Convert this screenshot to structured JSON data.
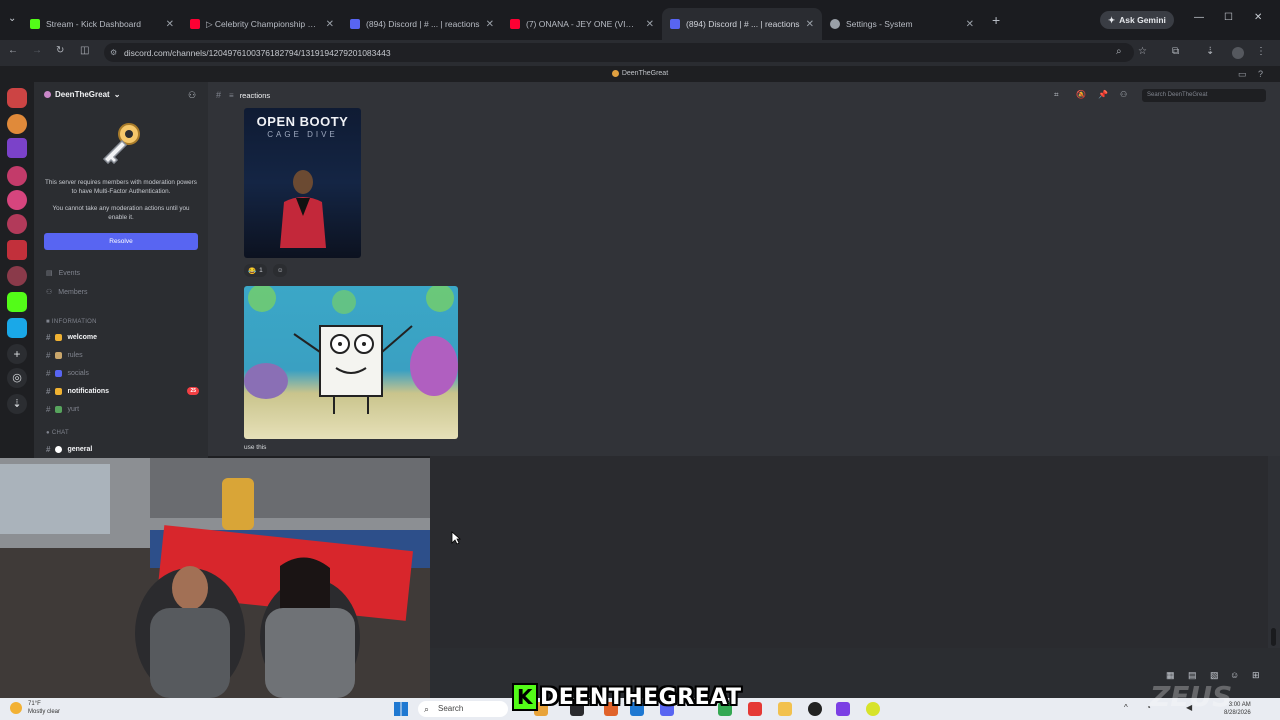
{
  "browser": {
    "tabs": [
      {
        "title": "Stream - Kick Dashboard",
        "color": "#53fc18"
      },
      {
        "title": "▷ Celebrity Championship Box",
        "color": "#ff0033"
      },
      {
        "title": "(894) Discord | # ... | reactions",
        "color": "#5865f2"
      },
      {
        "title": "(7) ONANA - JEY ONE (VIDEO O",
        "color": "#ff0033"
      },
      {
        "title": "(894) Discord | # ... | reactions",
        "color": "#5865f2"
      },
      {
        "title": "Settings - System",
        "color": "#9aa0a8"
      }
    ],
    "new_tab": "+",
    "ask_gemini": "Ask Gemini",
    "url": "discord.com/channels/1204976100376182794/1319194279201083443"
  },
  "discord": {
    "window_title": "DeenTheGreat",
    "server_name": "DeenTheGreat",
    "mfa_notice": "This server requires members with moderation powers to have Multi-Factor Authentication.",
    "mfa_notice_2": "You cannot take any moderation actions until you enable it.",
    "resolve_label": "Resolve",
    "nav": [
      {
        "label": "Events"
      },
      {
        "label": "Members"
      }
    ],
    "categories": {
      "information": "INFORMATION",
      "chat": "CHAT"
    },
    "channels": [
      {
        "name": "welcome",
        "emoji_color": "#f0b232",
        "bright": true
      },
      {
        "name": "rules",
        "emoji_color": "#c9a66b",
        "bright": false
      },
      {
        "name": "socials",
        "emoji_color": "#5865f2",
        "bright": false
      },
      {
        "name": "notifications",
        "emoji_color": "#f0b232",
        "bright": true,
        "badge": "25"
      },
      {
        "name": "yurt",
        "emoji_color": "#57a45d",
        "bright": false
      }
    ],
    "chat_channels": [
      {
        "name": "general",
        "emoji_color": "#ffffff",
        "bright": true
      }
    ],
    "channel_header": "reactions",
    "search_placeholder": "Search DeenTheGreat",
    "poster": {
      "title": "OPEN BOOTY",
      "subtitle": "CAGE DIVE"
    },
    "reactions": [
      {
        "emoji": "😂",
        "count": "1"
      },
      {
        "emoji": "☺",
        "count": ""
      }
    ],
    "caption": "use this"
  },
  "taskbar": {
    "weather_temp": "71°F",
    "weather_desc": "Mostly clear",
    "search": "Search",
    "time": "3:00 AM",
    "date": "8/28/2026"
  },
  "overlay": {
    "k": "K",
    "name": "DEENTHEGREAT"
  },
  "watermark": "ZEUS"
}
